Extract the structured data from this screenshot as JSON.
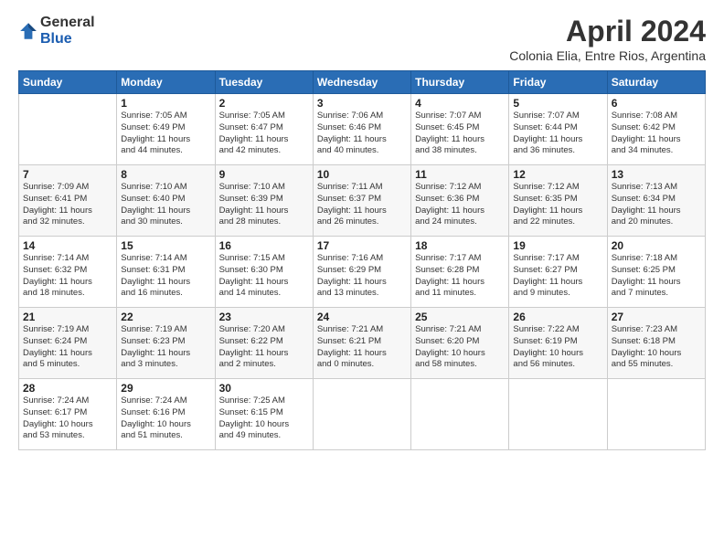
{
  "logo": {
    "general": "General",
    "blue": "Blue"
  },
  "header": {
    "title": "April 2024",
    "subtitle": "Colonia Elia, Entre Rios, Argentina"
  },
  "weekdays": [
    "Sunday",
    "Monday",
    "Tuesday",
    "Wednesday",
    "Thursday",
    "Friday",
    "Saturday"
  ],
  "weeks": [
    [
      {
        "day": "",
        "info": ""
      },
      {
        "day": "1",
        "info": "Sunrise: 7:05 AM\nSunset: 6:49 PM\nDaylight: 11 hours\nand 44 minutes."
      },
      {
        "day": "2",
        "info": "Sunrise: 7:05 AM\nSunset: 6:47 PM\nDaylight: 11 hours\nand 42 minutes."
      },
      {
        "day": "3",
        "info": "Sunrise: 7:06 AM\nSunset: 6:46 PM\nDaylight: 11 hours\nand 40 minutes."
      },
      {
        "day": "4",
        "info": "Sunrise: 7:07 AM\nSunset: 6:45 PM\nDaylight: 11 hours\nand 38 minutes."
      },
      {
        "day": "5",
        "info": "Sunrise: 7:07 AM\nSunset: 6:44 PM\nDaylight: 11 hours\nand 36 minutes."
      },
      {
        "day": "6",
        "info": "Sunrise: 7:08 AM\nSunset: 6:42 PM\nDaylight: 11 hours\nand 34 minutes."
      }
    ],
    [
      {
        "day": "7",
        "info": "Sunrise: 7:09 AM\nSunset: 6:41 PM\nDaylight: 11 hours\nand 32 minutes."
      },
      {
        "day": "8",
        "info": "Sunrise: 7:10 AM\nSunset: 6:40 PM\nDaylight: 11 hours\nand 30 minutes."
      },
      {
        "day": "9",
        "info": "Sunrise: 7:10 AM\nSunset: 6:39 PM\nDaylight: 11 hours\nand 28 minutes."
      },
      {
        "day": "10",
        "info": "Sunrise: 7:11 AM\nSunset: 6:37 PM\nDaylight: 11 hours\nand 26 minutes."
      },
      {
        "day": "11",
        "info": "Sunrise: 7:12 AM\nSunset: 6:36 PM\nDaylight: 11 hours\nand 24 minutes."
      },
      {
        "day": "12",
        "info": "Sunrise: 7:12 AM\nSunset: 6:35 PM\nDaylight: 11 hours\nand 22 minutes."
      },
      {
        "day": "13",
        "info": "Sunrise: 7:13 AM\nSunset: 6:34 PM\nDaylight: 11 hours\nand 20 minutes."
      }
    ],
    [
      {
        "day": "14",
        "info": "Sunrise: 7:14 AM\nSunset: 6:32 PM\nDaylight: 11 hours\nand 18 minutes."
      },
      {
        "day": "15",
        "info": "Sunrise: 7:14 AM\nSunset: 6:31 PM\nDaylight: 11 hours\nand 16 minutes."
      },
      {
        "day": "16",
        "info": "Sunrise: 7:15 AM\nSunset: 6:30 PM\nDaylight: 11 hours\nand 14 minutes."
      },
      {
        "day": "17",
        "info": "Sunrise: 7:16 AM\nSunset: 6:29 PM\nDaylight: 11 hours\nand 13 minutes."
      },
      {
        "day": "18",
        "info": "Sunrise: 7:17 AM\nSunset: 6:28 PM\nDaylight: 11 hours\nand 11 minutes."
      },
      {
        "day": "19",
        "info": "Sunrise: 7:17 AM\nSunset: 6:27 PM\nDaylight: 11 hours\nand 9 minutes."
      },
      {
        "day": "20",
        "info": "Sunrise: 7:18 AM\nSunset: 6:25 PM\nDaylight: 11 hours\nand 7 minutes."
      }
    ],
    [
      {
        "day": "21",
        "info": "Sunrise: 7:19 AM\nSunset: 6:24 PM\nDaylight: 11 hours\nand 5 minutes."
      },
      {
        "day": "22",
        "info": "Sunrise: 7:19 AM\nSunset: 6:23 PM\nDaylight: 11 hours\nand 3 minutes."
      },
      {
        "day": "23",
        "info": "Sunrise: 7:20 AM\nSunset: 6:22 PM\nDaylight: 11 hours\nand 2 minutes."
      },
      {
        "day": "24",
        "info": "Sunrise: 7:21 AM\nSunset: 6:21 PM\nDaylight: 11 hours\nand 0 minutes."
      },
      {
        "day": "25",
        "info": "Sunrise: 7:21 AM\nSunset: 6:20 PM\nDaylight: 10 hours\nand 58 minutes."
      },
      {
        "day": "26",
        "info": "Sunrise: 7:22 AM\nSunset: 6:19 PM\nDaylight: 10 hours\nand 56 minutes."
      },
      {
        "day": "27",
        "info": "Sunrise: 7:23 AM\nSunset: 6:18 PM\nDaylight: 10 hours\nand 55 minutes."
      }
    ],
    [
      {
        "day": "28",
        "info": "Sunrise: 7:24 AM\nSunset: 6:17 PM\nDaylight: 10 hours\nand 53 minutes."
      },
      {
        "day": "29",
        "info": "Sunrise: 7:24 AM\nSunset: 6:16 PM\nDaylight: 10 hours\nand 51 minutes."
      },
      {
        "day": "30",
        "info": "Sunrise: 7:25 AM\nSunset: 6:15 PM\nDaylight: 10 hours\nand 49 minutes."
      },
      {
        "day": "",
        "info": ""
      },
      {
        "day": "",
        "info": ""
      },
      {
        "day": "",
        "info": ""
      },
      {
        "day": "",
        "info": ""
      }
    ]
  ]
}
